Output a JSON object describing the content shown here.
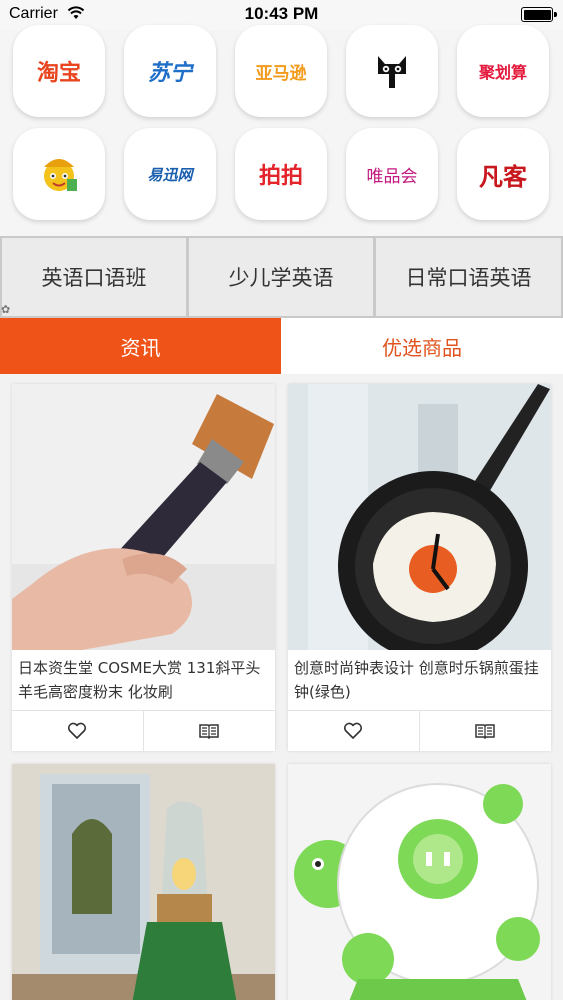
{
  "status_bar": {
    "carrier": "Carrier",
    "time": "10:43 PM"
  },
  "shops": [
    {
      "label": "淘宝",
      "color": "#e8451e"
    },
    {
      "label": "苏宁",
      "color": "#1f6fc8"
    },
    {
      "label": "亚马逊",
      "color": "#f29a1c"
    },
    {
      "label": "天猫",
      "icon": "tmall-cat-icon",
      "color": "#111111"
    },
    {
      "label": "聚划算",
      "color": "#e4193c"
    },
    {
      "label": "一号店",
      "icon": "yhd-mascot-icon",
      "color": "#f3c21b"
    },
    {
      "label": "易迅网",
      "color": "#1a5fae"
    },
    {
      "label": "拍拍",
      "color": "#e3242b"
    },
    {
      "label": "唯品会",
      "color": "#c21a7e"
    },
    {
      "label": "凡客",
      "color": "#c8161d"
    }
  ],
  "courses": [
    "英语口语班",
    "少儿学英语",
    "日常口语英语"
  ],
  "tabs": {
    "news": "资讯",
    "products": "优选商品"
  },
  "accent_color": "#f05318",
  "products": [
    {
      "title": "日本资生堂 COSME大赏 131斜平头羊毛高密度粉末 化妆刷",
      "image": "makeup-brush-photo"
    },
    {
      "title": "创意时尚钟表设计 创意时乐锅煎蛋挂钟(绿色)",
      "image": "frying-pan-clock-photo"
    },
    {
      "title": "",
      "image": "kerosene-lamp-photo"
    },
    {
      "title": "",
      "image": "turtle-power-strip-photo"
    }
  ]
}
